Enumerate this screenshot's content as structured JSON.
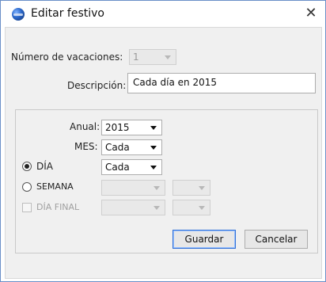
{
  "window": {
    "title": "Editar festivo",
    "close_glyph": "✕",
    "icon": "app-globe-icon"
  },
  "form": {
    "num_vacaciones_label": "Número de vacaciones:",
    "num_vacaciones_value": "1",
    "descripcion_label": "Descripción:",
    "descripcion_value": "Cada día en 2015"
  },
  "schedule": {
    "anual_label": "Anual:",
    "anual_value": "2015",
    "mes_label": "MES:",
    "mes_value": "Cada",
    "dia_label": "DÍA",
    "dia_value": "Cada",
    "dia_selected": true,
    "semana_label": "SEMANA",
    "semana_selected": false,
    "dia_final_label": "DÍA FINAL",
    "dia_final_checked": false
  },
  "buttons": {
    "guardar": "Guardar",
    "cancelar": "Cancelar"
  },
  "colors": {
    "window_border": "#6a8fc8",
    "client_bg": "#f0f0f0",
    "default_button_border": "#2f6fd6"
  }
}
